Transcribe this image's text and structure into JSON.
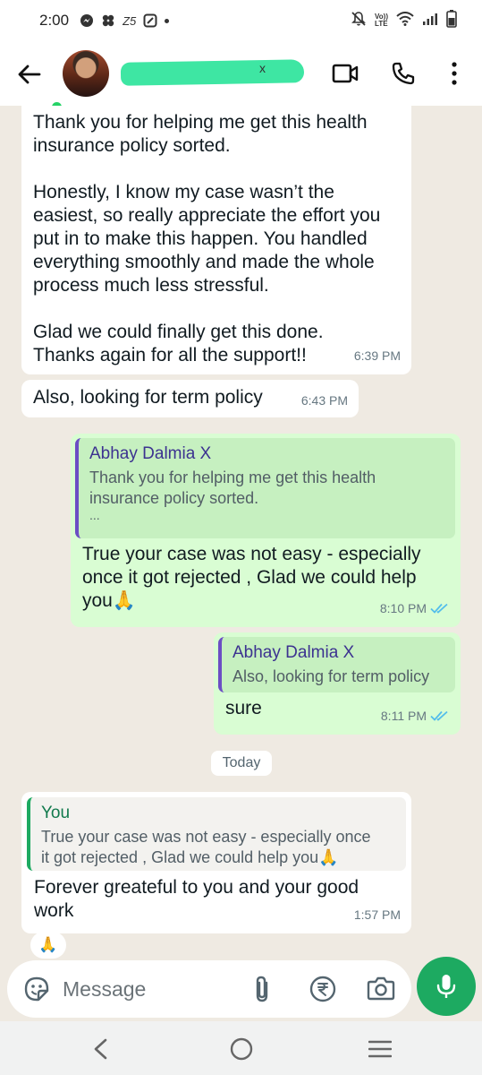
{
  "status_bar": {
    "time": "2:00",
    "indicators": [
      "messenger-icon",
      "pinwheel-icon",
      "z5-icon",
      "edit-box-icon",
      "dot-icon"
    ],
    "right_icons": [
      "mute-icon",
      "volte-icon",
      "wifi-icon",
      "signal-icon",
      "battery-icon"
    ],
    "network_badge_top": "Vo))",
    "network_badge_bottom": "LTE",
    "notif_text": "Z5"
  },
  "header": {
    "back_icon": "arrow-left-icon",
    "contact_name_visible_suffix": "x",
    "name_redacted": true,
    "online": true,
    "actions": [
      "video-call-icon",
      "phone-icon",
      "more-vert-icon"
    ]
  },
  "messages": [
    {
      "direction": "in",
      "text": "Thank you for helping me get this health\ninsurance policy sorted.\n\nHonestly, I know my case wasn’t the\neasiest, so really appreciate the effort you\nput in to make this happen. You handled\neverything smoothly and made the whole\nprocess much less stressful.\n\nGlad we could finally get this done.\nThanks again for all the support!!",
      "time": "6:39 PM"
    },
    {
      "direction": "in",
      "text": "Also, looking for term policy",
      "time": "6:43 PM"
    },
    {
      "direction": "out",
      "quote_author": "Abhay Dalmia X",
      "quote_text": "Thank you for helping me get this health\ninsurance policy sorted.",
      "quote_ellipsis": "...",
      "text": "True your case was not easy - especially\nonce it got rejected , Glad we could help\nyou🙏",
      "time": "8:10 PM",
      "read": true
    },
    {
      "direction": "out",
      "quote_author": "Abhay Dalmia X",
      "quote_text": "Also, looking for term policy",
      "text": "sure",
      "time": "8:11 PM",
      "read": true
    },
    {
      "direction": "in",
      "quote_author": "You",
      "quote_text": "True your case was not easy - especially once\nit got rejected , Glad we could help you🙏",
      "text": "Forever greateful to you and your good\nwork",
      "time": "1:57 PM",
      "reaction": "🙏"
    }
  ],
  "date_divider": "Today",
  "compose": {
    "placeholder": "Message",
    "icons": [
      "sticker-icon",
      "paperclip-icon",
      "rupee-icon",
      "camera-icon",
      "mic-icon"
    ]
  },
  "colors": {
    "chat_bg": "#efeae2",
    "incoming_bubble": "#ffffff",
    "outgoing_bubble": "#d9fdd3",
    "accent_green": "#1daa61",
    "read_ticks": "#53bdeb",
    "name_scribble": "#3ee6a3"
  },
  "nav_bar": {
    "icons": [
      "nav-back-icon",
      "nav-home-icon",
      "nav-recents-icon"
    ]
  }
}
